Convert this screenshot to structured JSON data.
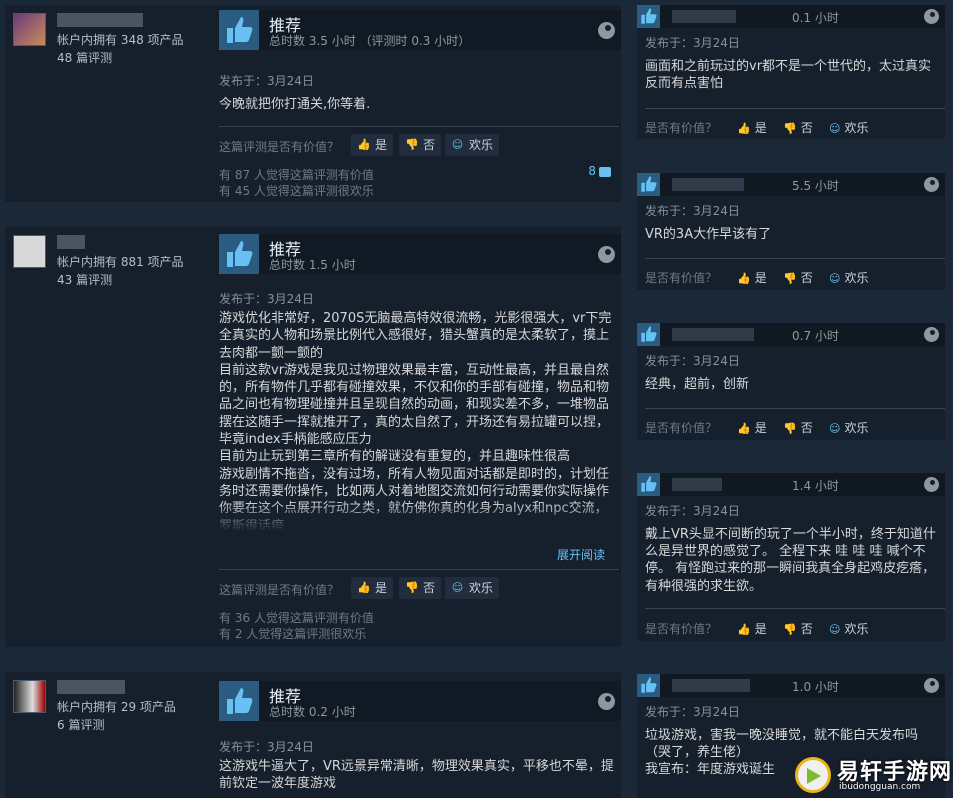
{
  "reviews": [
    {
      "owned": "帐户内拥有 348 项产品",
      "reviews_count": "48 篇评测",
      "verdict": "推荐",
      "hours": "总时数 3.5 小时 （评测时 0.3 小时）",
      "posted": "发布于：3月24日",
      "text": "今晚就把你打通关,你等着.",
      "helpful_question": "这篇评测是否有价值？",
      "yes": "是",
      "no": "否",
      "funny": "欢乐",
      "helpful_count": "有 87 人觉得这篇评测有价值",
      "funny_count": "有 45 人觉得这篇评测很欢乐",
      "comments": "8"
    },
    {
      "owned": "帐户内拥有 881 项产品",
      "reviews_count": "43 篇评测",
      "verdict": "推荐",
      "hours": "总时数 1.5 小时",
      "posted": "发布于：3月24日",
      "text": "游戏优化非常好，2070S无脑最高特效很流畅，光影很强大，vr下完全真实的人物和场景比例代入感很好，猎头蟹真的是太柔软了，摸上去肉都一颤一颤的\n目前这款vr游戏是我见过物理效果最丰富，互动性最高，并且最自然的，所有物件几乎都有碰撞效果，不仅和你的手部有碰撞，物品和物品之间也有物理碰撞并且呈现自然的动画，和现实差不多，一堆物品摆在这随手一挥就推开了，真的太自然了，开场还有易拉罐可以捏，毕竟index手柄能感应压力\n目前为止玩到第三章所有的解谜没有重复的，并且趣味性很高\n游戏剧情不拖沓，没有过场，所有人物见面对话都是即时的，计划任务时还需要你操作，比如两人对着地图交流如何行动需要你实际操作你要在这个点展开行动之类，就仿佛你真的化身为alyx和npc交流，罗斯很话痨",
      "read_more": "展开阅读",
      "helpful_question": "这篇评测是否有价值？",
      "yes": "是",
      "no": "否",
      "funny": "欢乐",
      "helpful_count": "有 36 人觉得这篇评测有价值",
      "funny_count": "有 2 人觉得这篇评测很欢乐"
    },
    {
      "owned": "帐户内拥有 29 项产品",
      "reviews_count": "6 篇评测",
      "verdict": "推荐",
      "hours": "总时数 0.2 小时",
      "posted": "发布于：3月24日",
      "text": "这游戏牛逼大了，VR远景异常清晰，物理效果真实，平移也不晕，提前钦定一波年度游戏"
    }
  ],
  "side_reviews": [
    {
      "hours": "0.1 小时",
      "posted": "发布于：3月24日",
      "text": "画面和之前玩过的vr都不是一个世代的，太过真实反而有点害怕",
      "q": "是否有价值？",
      "yes": "是",
      "no": "否",
      "funny": "欢乐"
    },
    {
      "hours": "5.5 小时",
      "posted": "发布于：3月24日",
      "text": "VR的3A大作早该有了",
      "q": "是否有价值？",
      "yes": "是",
      "no": "否",
      "funny": "欢乐"
    },
    {
      "hours": "0.7 小时",
      "posted": "发布于：3月24日",
      "text": "经典，超前，创新",
      "q": "是否有价值？",
      "yes": "是",
      "no": "否",
      "funny": "欢乐"
    },
    {
      "hours": "1.4 小时",
      "posted": "发布于：3月24日",
      "text": "戴上VR头显不间断的玩了一个半小时，终于知道什么是异世界的感觉了。 全程下来 哇 哇 哇 喊个不停。 有怪跑过来的那一瞬间我真全身起鸡皮疙瘩，有种很强的求生欲。",
      "q": "是否有价值？",
      "yes": "是",
      "no": "否",
      "funny": "欢乐"
    },
    {
      "hours": "1.0 小时",
      "posted": "发布于：3月24日",
      "text": "垃圾游戏，害我一晚没睡觉，就不能白天发布吗（哭了，养生佬）\n我宣布：年度游戏诞生"
    }
  ],
  "watermark": {
    "name": "易轩手游网",
    "url": "ibudongguan.com"
  },
  "colors": {
    "accent": "#66c0f4",
    "thumb_bg": "#2a5b80",
    "page_bg": "#1b2838",
    "card_bg": "#16202d"
  }
}
